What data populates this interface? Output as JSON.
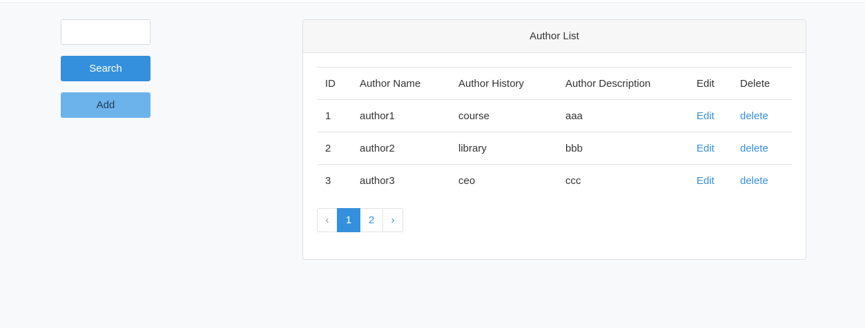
{
  "search": {
    "value": "",
    "placeholder": "",
    "search_button_label": "Search",
    "add_button_label": "Add"
  },
  "author_list": {
    "title": "Author List",
    "columns": [
      "ID",
      "Author Name",
      "Author History",
      "Author Description",
      "Edit",
      "Delete"
    ],
    "rows": [
      {
        "id": "1",
        "name": "author1",
        "history": "course",
        "description": "aaa",
        "edit": "Edit",
        "delete": "delete"
      },
      {
        "id": "2",
        "name": "author2",
        "history": "library",
        "description": "bbb",
        "edit": "Edit",
        "delete": "delete"
      },
      {
        "id": "3",
        "name": "author3",
        "history": "ceo",
        "description": "ccc",
        "edit": "Edit",
        "delete": "delete"
      }
    ]
  },
  "pagination": {
    "prev": "‹",
    "pages": [
      "1",
      "2"
    ],
    "current": "1",
    "next": "›"
  },
  "colors": {
    "primary": "#3490dc",
    "info": "#6cb2eb",
    "background": "#f8f9fa"
  }
}
